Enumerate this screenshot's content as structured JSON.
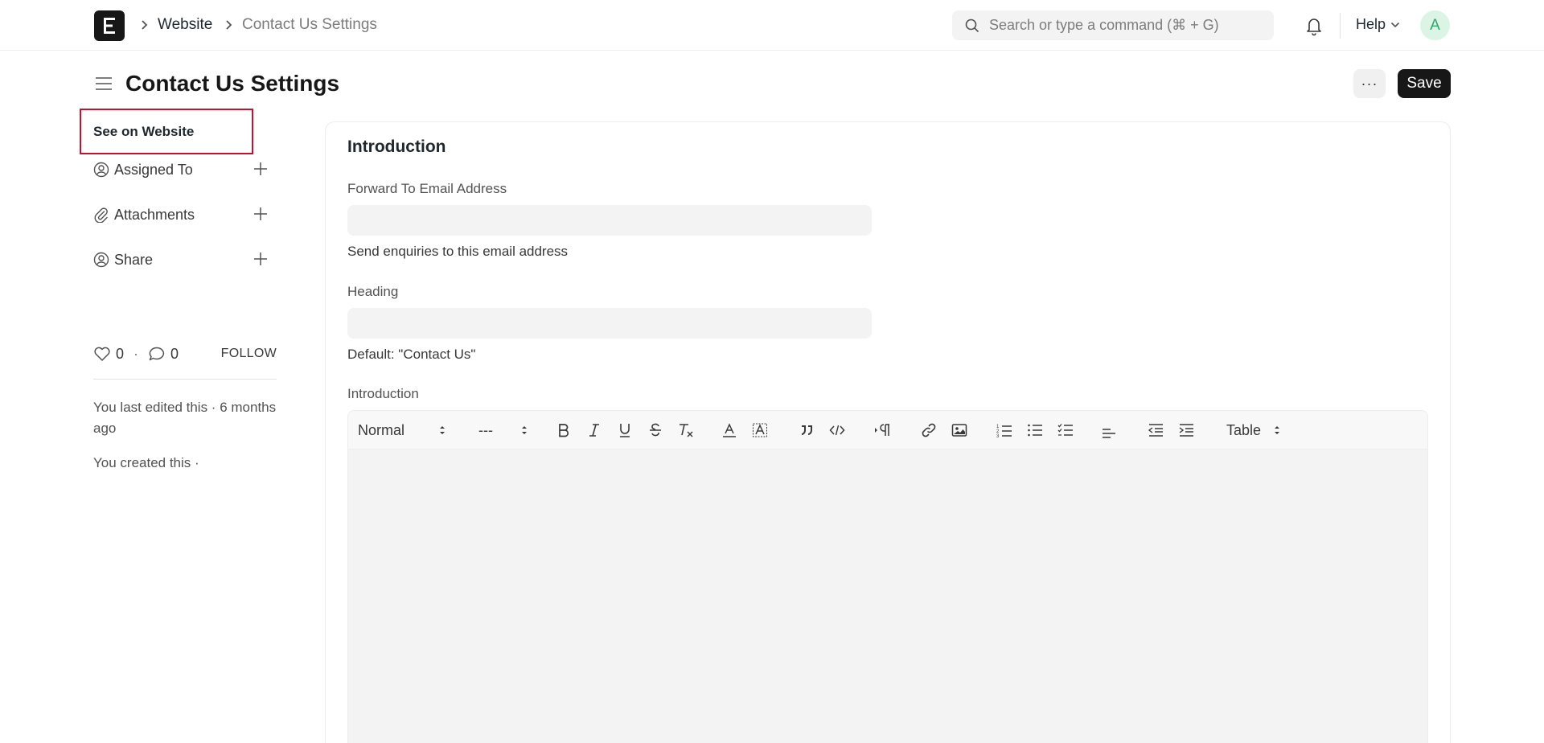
{
  "navbar": {
    "breadcrumbs": [
      "Website",
      "Contact Us Settings"
    ],
    "search_placeholder": "Search or type a command (⌘ + G)",
    "help_label": "Help",
    "avatar_initial": "A"
  },
  "page": {
    "title": "Contact Us Settings",
    "more_label": "···",
    "save_label": "Save"
  },
  "sidebar": {
    "see_on_website": "See on Website",
    "items": [
      {
        "label": "Assigned To",
        "icon": "assign-user-icon"
      },
      {
        "label": "Attachments",
        "icon": "paperclip-icon"
      },
      {
        "label": "Share",
        "icon": "share-user-icon"
      }
    ],
    "likes": "0",
    "comments": "0",
    "follow_label": "FOLLOW",
    "last_edited": "You last edited this · 6 months ago",
    "created": "You created this ·"
  },
  "form": {
    "section_title": "Introduction",
    "fields": [
      {
        "label": "Forward To Email Address",
        "value": "",
        "description": "Send enquiries to this email address"
      },
      {
        "label": "Heading",
        "value": "",
        "description": "Default: \"Contact Us\""
      }
    ],
    "editor": {
      "label": "Introduction",
      "paragraph_style": "Normal",
      "font_size": "---",
      "table_label": "Table"
    }
  },
  "colors": {
    "highlight_border": "#c8102e",
    "primary_button": "#171717",
    "avatar_bg": "#dcf4e6",
    "avatar_fg": "#30a66d"
  }
}
